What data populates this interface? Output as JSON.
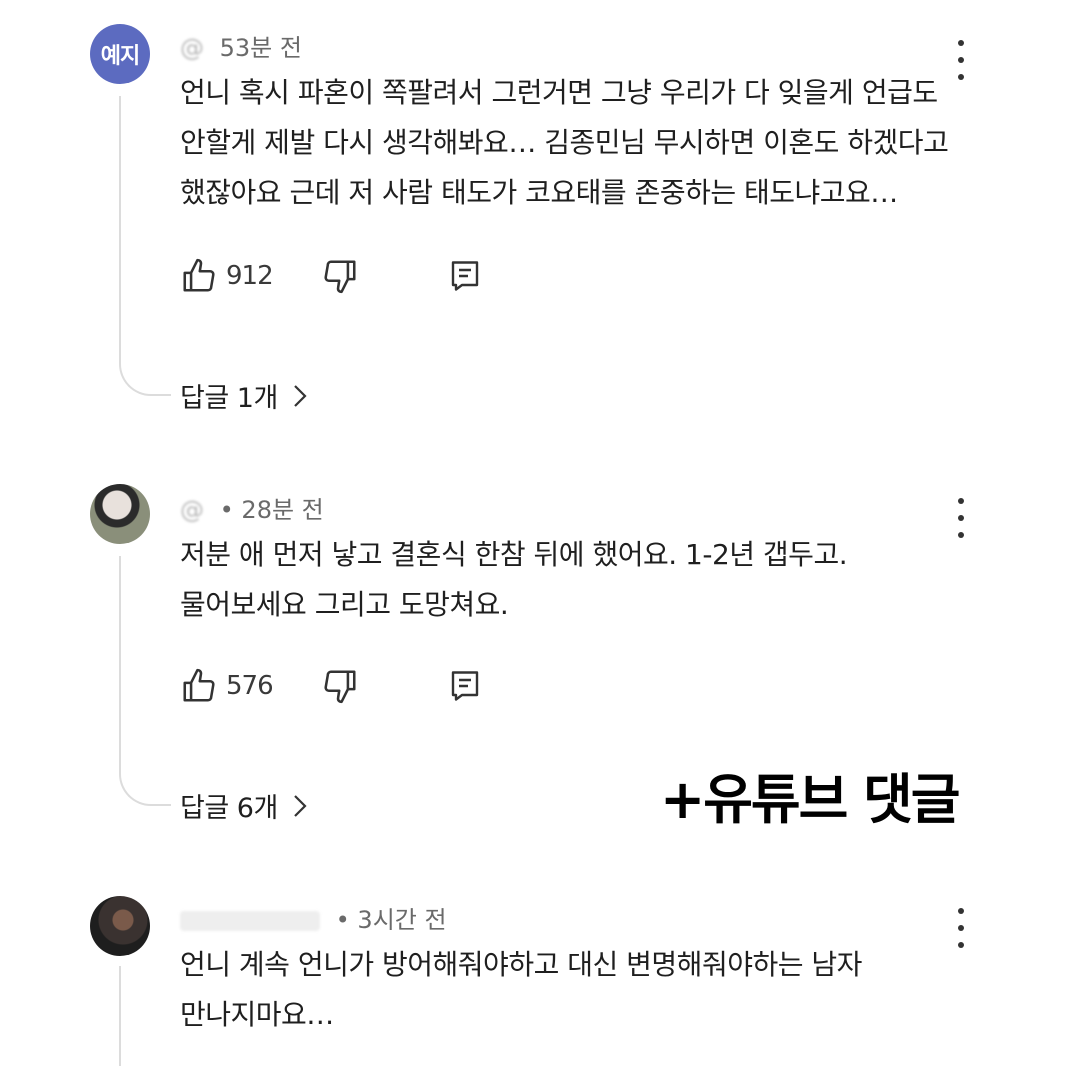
{
  "comments": [
    {
      "avatar_text": "예지",
      "handle": "@",
      "time": "53분 전",
      "lines": [
        "언니 혹시 파혼이 쪽팔려서 그런거면 그냥 우리가 다 잊을게 언급도",
        "안할게 제발 다시 생각해봐요… 김종민님 무시하면 이혼도 하겠다고",
        "했잖아요 근데 저 사람 태도가 코요태를 존중하는 태도냐고요…"
      ],
      "likes": "912",
      "replies": "답글 1개"
    },
    {
      "handle": "@",
      "time": "• 28분 전",
      "lines": [
        "저분 애 먼저 낳고 결혼식 한참 뒤에 했어요. 1-2년 갭두고.",
        "물어보세요 그리고 도망쳐요."
      ],
      "likes": "576",
      "replies": "답글 6개"
    },
    {
      "handle": "",
      "time": "• 3시간 전",
      "lines": [
        "언니 계속 언니가 방어해줘야하고 대신 변명해줘야하는 남자",
        "만나지마요…"
      ]
    }
  ],
  "caption": "+유튜브 댓글",
  "icons": {
    "like": "thumbs-up-icon",
    "dislike": "thumbs-down-icon",
    "reply": "comment-icon",
    "more": "more-vertical-icon",
    "chevron": "chevron-right-icon"
  },
  "colors": {
    "avatar_bg": "#5c6bc0",
    "text": "#1f1f1f",
    "meta": "#6a6a6a"
  }
}
